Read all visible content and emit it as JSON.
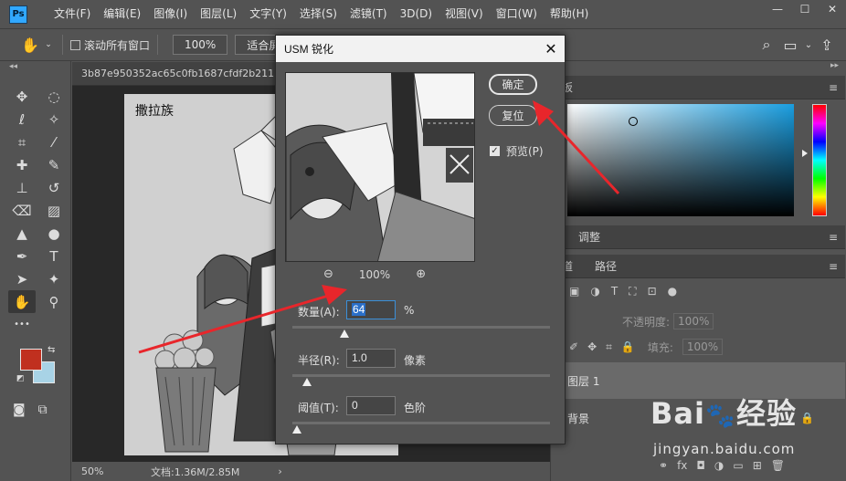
{
  "app": {
    "logo": "Ps"
  },
  "menu": [
    "文件(F)",
    "编辑(E)",
    "图像(I)",
    "图层(L)",
    "文字(Y)",
    "选择(S)",
    "滤镜(T)",
    "3D(D)",
    "视图(V)",
    "窗口(W)",
    "帮助(H)"
  ],
  "options_bar": {
    "scroll_all_label": "滚动所有窗口",
    "zoom_value": "100%",
    "fit_screen_label": "适合屏"
  },
  "document": {
    "tab_title": "3b87e950352ac65c0fb1687cfdf2b211",
    "watermark_text": "撒拉族",
    "zoom": "50%",
    "doc_size": "文档:1.36M/2.85M"
  },
  "tools": {
    "more": "•••"
  },
  "right_panel": {
    "color_tab_fragment": "板",
    "adjust_tab": "调整",
    "channels_tab_fragment": "道",
    "paths_tab": "路径",
    "opacity_label": "不透明度:",
    "opacity_value": "100%",
    "fill_label": "填充:",
    "fill_value": "100%",
    "layers": [
      {
        "name": "图层 1"
      },
      {
        "name": "背景"
      }
    ]
  },
  "usm_dialog": {
    "title": "USM 锐化",
    "ok_label": "确定",
    "reset_label": "复位",
    "preview_label": "预览(P)",
    "preview_zoom": "100%",
    "amount": {
      "label": "数量(A):",
      "value": "64",
      "unit": "%",
      "fraction": 0.19
    },
    "radius": {
      "label": "半径(R):",
      "value": "1.0",
      "unit": "像素",
      "fraction": 0.04
    },
    "threshold": {
      "label": "阈值(T):",
      "value": "0",
      "unit": "色阶",
      "fraction": 0.0
    }
  },
  "watermark": {
    "brand": "Bai",
    "brand_suffix": "经验",
    "site": "jingyan.baidu.com"
  },
  "colors": {
    "foreground": "#c0301f",
    "background": "#a8d3e6",
    "arrow": "#e8262b"
  }
}
